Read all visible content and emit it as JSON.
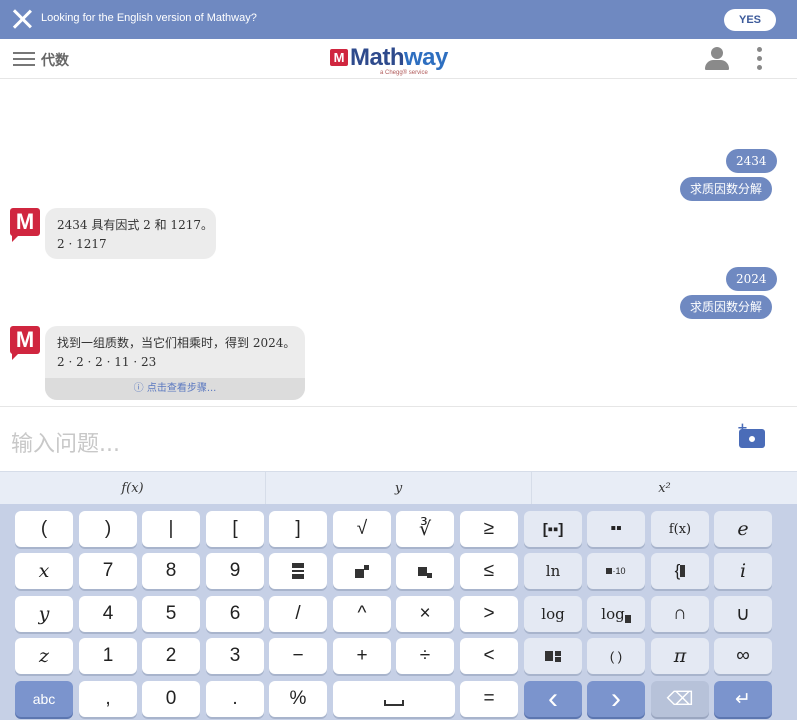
{
  "banner": {
    "message": "Looking for the English version of Mathway?",
    "yes_label": "YES"
  },
  "header": {
    "subject": "代数",
    "logo_text_a": "Math",
    "logo_text_b": "way",
    "logo_tagline": "a Chegg® service"
  },
  "chat": {
    "messages": [
      {
        "input": "2434",
        "command": "求质因数分解",
        "answer_line1": "2434 具有因式 2 和 1217。",
        "answer_line2": "2 · 1217"
      },
      {
        "input": "2024",
        "command": "求质因数分解",
        "answer_line1": "找到一组质数，当它们相乘时，得到 2024。",
        "answer_line2": "2 · 2 · 2 · 11 · 23",
        "steps_label": "ⓘ 点击查看步骤..."
      }
    ]
  },
  "input": {
    "placeholder": "输入问题..."
  },
  "tabs": [
    "f(x)",
    "y",
    "x²"
  ],
  "keys": {
    "row1": [
      "(",
      ")",
      "|",
      "[",
      "]",
      "√",
      "∛",
      "≥",
      "",
      "",
      "f(x)",
      "e"
    ],
    "row2": [
      "x",
      "7",
      "8",
      "9",
      "",
      "",
      "",
      "≤",
      "ln",
      "·10",
      "{",
      "i"
    ],
    "row3": [
      "y",
      "4",
      "5",
      "6",
      "/",
      "^",
      "×",
      ">",
      "log",
      "log",
      "∩",
      "∪"
    ],
    "row4": [
      "z",
      "1",
      "2",
      "3",
      "−",
      "+",
      "÷",
      "<",
      "",
      "( )",
      "π",
      "∞"
    ],
    "row5": [
      "abc",
      ",",
      "0",
      ".",
      "%",
      "",
      "=",
      "‹",
      "›",
      "⌫",
      "↵"
    ]
  }
}
